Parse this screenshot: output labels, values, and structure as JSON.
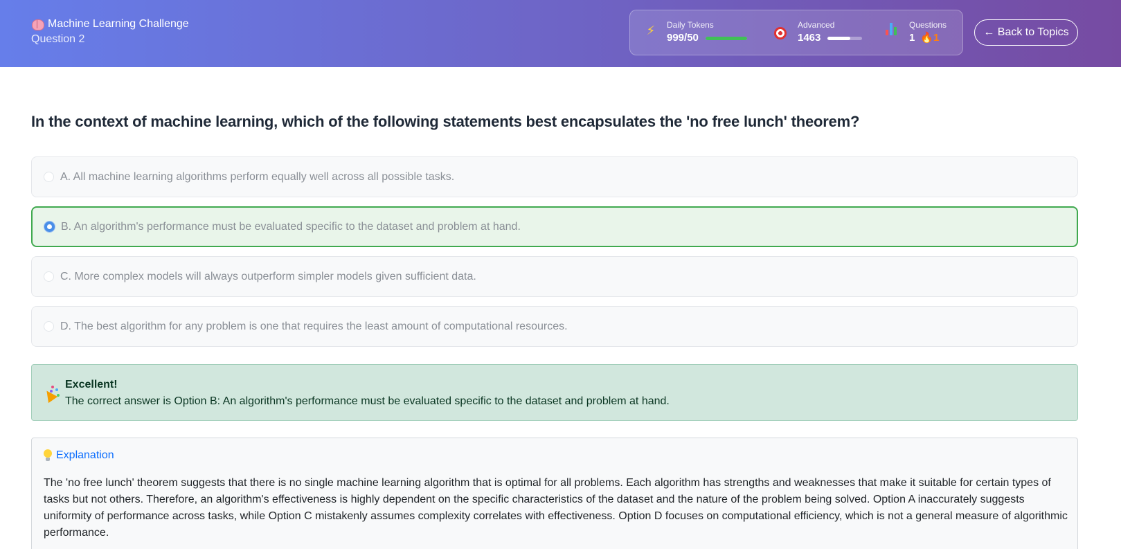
{
  "header": {
    "title": "Machine Learning Challenge",
    "subtitle": "Question 2",
    "back_label": "← Back to Topics"
  },
  "stats": {
    "tokens": {
      "label": "Daily Tokens",
      "value": "999/50",
      "progress": 1.0,
      "color": "#40c057"
    },
    "level": {
      "label": "Advanced",
      "value": "1463",
      "progress": 0.65,
      "color": "#ffffff"
    },
    "questions": {
      "label": "Questions",
      "value": "1",
      "streak": "1"
    }
  },
  "question": {
    "text": "In the context of machine learning, which of the following statements best encapsulates the 'no free lunch' theorem?",
    "options": [
      {
        "label": "A. All machine learning algorithms perform equally well across all possible tasks.",
        "selected": false
      },
      {
        "label": "B. An algorithm's performance must be evaluated specific to the dataset and problem at hand.",
        "selected": true
      },
      {
        "label": "C. More complex models will always outperform simpler models given sufficient data.",
        "selected": false
      },
      {
        "label": "D. The best algorithm for any problem is one that requires the least amount of computational resources.",
        "selected": false
      }
    ]
  },
  "result": {
    "title": "Excellent!",
    "text": "The correct answer is Option B: An algorithm's performance must be evaluated specific to the dataset and problem at hand."
  },
  "explanation": {
    "title": "Explanation",
    "text": "The 'no free lunch' theorem suggests that there is no single machine learning algorithm that is optimal for all problems. Each algorithm has strengths and weaknesses that make it suitable for certain types of tasks but not others. Therefore, an algorithm's effectiveness is highly dependent on the specific characteristics of the dataset and the nature of the problem being solved. Option A inaccurately suggests uniformity of performance across tasks, while Option C mistakenly assumes complexity correlates with effectiveness. Option D focuses on computational efficiency, which is not a general measure of algorithmic performance."
  },
  "colors": {
    "header_start": "#667eea",
    "header_end": "#764ba2",
    "selected_border": "#40a94f",
    "success_bg": "#d1e7dd",
    "link": "#0d6efd"
  }
}
